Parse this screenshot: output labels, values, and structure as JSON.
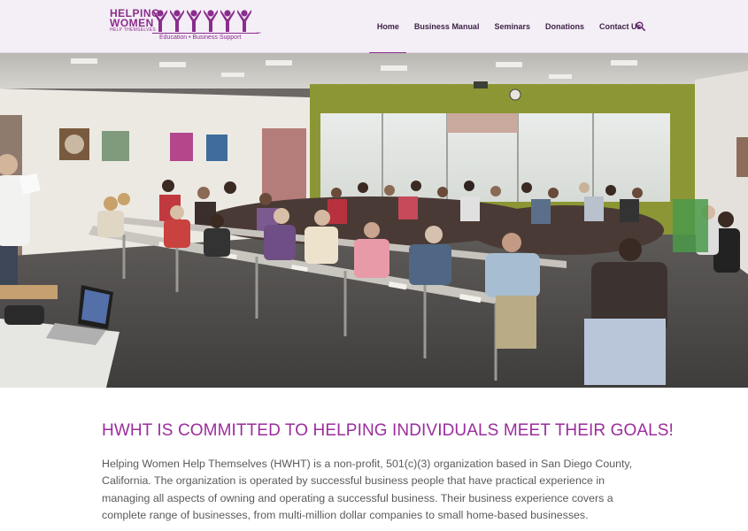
{
  "logo": {
    "line1": "HELPING",
    "line2": "WOMEN",
    "line3": "HELP THEMSELVES",
    "tagline": "Education • Business Support",
    "tm": "SM",
    "brand_color": "#8a2d8c"
  },
  "nav": {
    "items": [
      {
        "label": "Home",
        "active": true
      },
      {
        "label": "Business Manual",
        "active": false
      },
      {
        "label": "Seminars",
        "active": false
      },
      {
        "label": "Donations",
        "active": false
      },
      {
        "label": "Contact Us",
        "active": false
      }
    ],
    "search_icon": "search-icon"
  },
  "hero": {
    "image": "seminar-classroom-photo",
    "slide_count": 1,
    "active_slide": 1
  },
  "main": {
    "headline": "HWHT IS COMMITTED TO HELPING INDIVIDUALS MEET THEIR GOALS!",
    "paragraph": "Helping Women Help Themselves (HWHT) is a non-profit, 501(c)(3) organization based in San Diego County, California. The organization is operated by successful business people that have practical experience in managing all aspects of owning and operating a successful business. Their business experience covers a complete range of businesses, from multi-million dollar companies to small home-based businesses.",
    "headline_color": "#9b2d9d",
    "text_color": "#5a5a5a"
  }
}
